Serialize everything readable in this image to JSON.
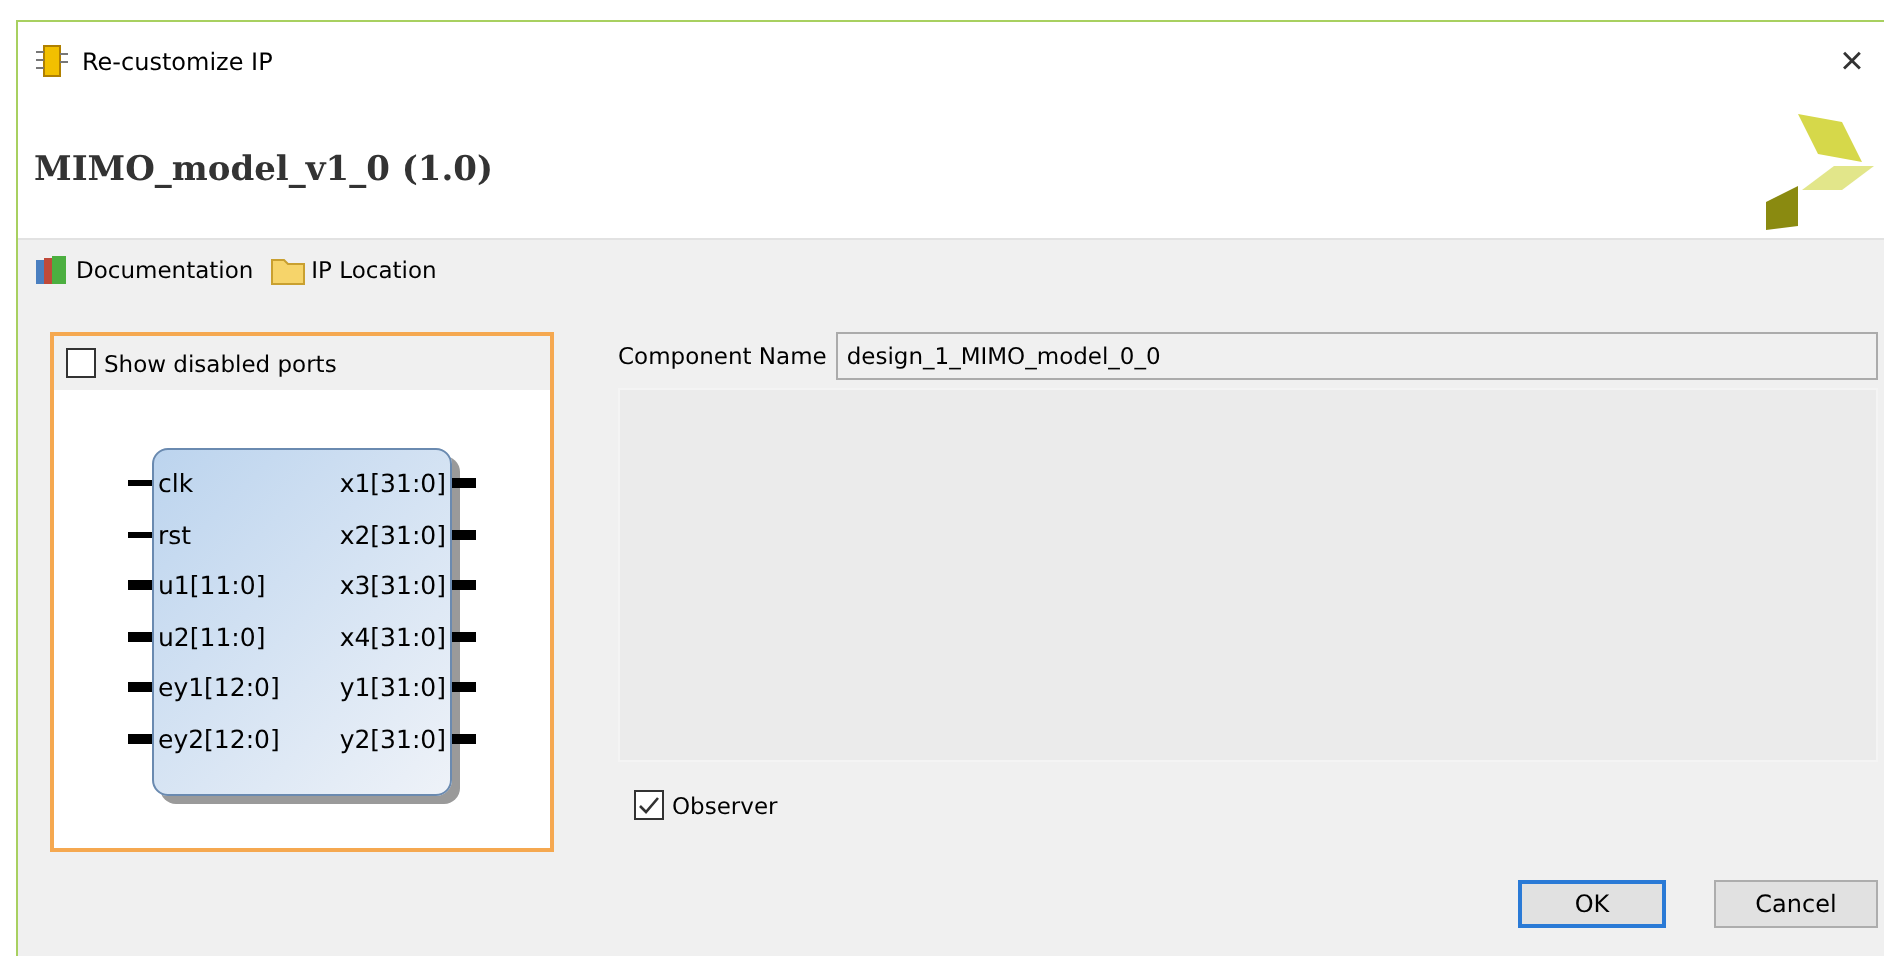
{
  "window": {
    "title": "Re-customize IP",
    "close": "×"
  },
  "header": {
    "title": "MIMO_model_v1_0 (1.0)"
  },
  "toolbar": [
    {
      "kind": "docs",
      "label": "Documentation"
    },
    {
      "kind": "folder",
      "label": "IP Location"
    }
  ],
  "symbol_panel": {
    "show_disabled_ports": {
      "label": "Show disabled ports",
      "checked": false
    },
    "inputs": [
      {
        "name": "clk",
        "bus": false
      },
      {
        "name": "rst",
        "bus": false
      },
      {
        "name": "u1[11:0]",
        "bus": true
      },
      {
        "name": "u2[11:0]",
        "bus": true
      },
      {
        "name": "ey1[12:0]",
        "bus": true
      },
      {
        "name": "ey2[12:0]",
        "bus": true
      }
    ],
    "outputs": [
      {
        "name": "x1[31:0]",
        "bus": true
      },
      {
        "name": "x2[31:0]",
        "bus": true
      },
      {
        "name": "x3[31:0]",
        "bus": true
      },
      {
        "name": "x4[31:0]",
        "bus": true
      },
      {
        "name": "y1[31:0]",
        "bus": true
      },
      {
        "name": "y2[31:0]",
        "bus": true
      }
    ]
  },
  "component_name": {
    "label": "Component Name",
    "value": "design_1_MIMO_model_0_0"
  },
  "observer": {
    "label": "Observer",
    "checked": true
  },
  "buttons": [
    {
      "label": "OK",
      "default": true
    },
    {
      "label": "Cancel",
      "default": false
    }
  ]
}
